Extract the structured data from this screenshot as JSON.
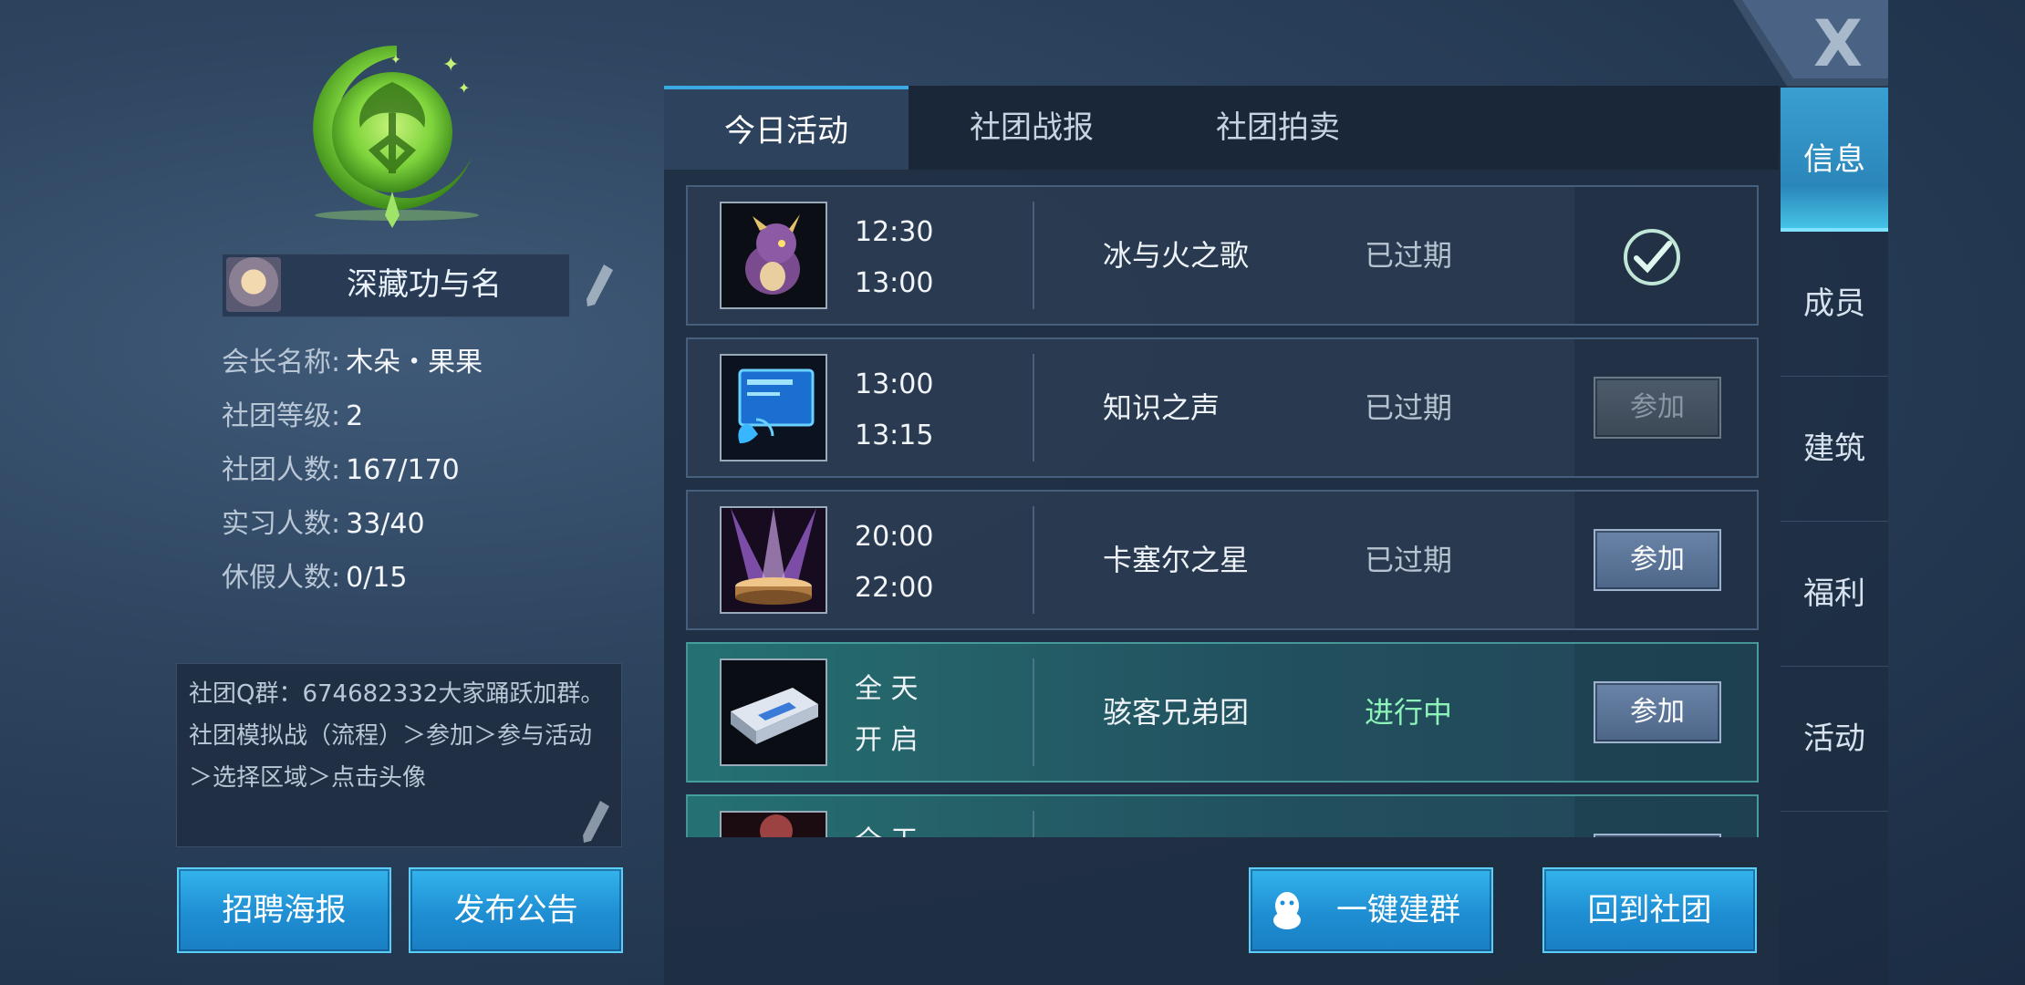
{
  "close_label": "X",
  "clan": {
    "name": "深藏功与名",
    "info": [
      {
        "label": "会长名称:",
        "value": "木朵・果果"
      },
      {
        "label": "社团等级:",
        "value": "2"
      },
      {
        "label": "社团人数:",
        "value": "167/170"
      },
      {
        "label": "实习人数:",
        "value": "33/40"
      },
      {
        "label": "休假人数:",
        "value": "0/15"
      }
    ],
    "notice_lines": [
      "社团Q群：674682332大家踊跃加群。",
      "社团模拟战（流程）＞参加＞参与活动",
      "＞选择区域＞点击头像"
    ]
  },
  "left_buttons": {
    "recruit": "招聘海报",
    "announce": "发布公告"
  },
  "tabs": [
    {
      "label": "今日活动",
      "active": true
    },
    {
      "label": "社团战报",
      "active": false
    },
    {
      "label": "社团拍卖",
      "active": false
    }
  ],
  "activities": [
    {
      "start": "12:30",
      "end": "13:00",
      "name": "冰与火之歌",
      "status": "已过期",
      "action": "done",
      "icon": "dragon-icon"
    },
    {
      "start": "13:00",
      "end": "13:15",
      "name": "知识之声",
      "status": "已过期",
      "action": "参加",
      "action_disabled": true,
      "icon": "phone-screen-icon"
    },
    {
      "start": "20:00",
      "end": "22:00",
      "name": "卡塞尔之星",
      "status": "已过期",
      "action": "参加",
      "icon": "stage-lights-icon"
    },
    {
      "start": "全 天",
      "end": "开 启",
      "name": "骇客兄弟团",
      "status": "进行中",
      "action": "参加",
      "icon": "hard-drive-icon"
    },
    {
      "start": "全 天",
      "end": "",
      "name": "",
      "status": "",
      "action": "",
      "icon": "partial-icon"
    }
  ],
  "bottom_buttons": {
    "group": "一键建群",
    "return": "回到社团"
  },
  "sidebar": [
    {
      "label": "信息",
      "active": true
    },
    {
      "label": "成员",
      "active": false
    },
    {
      "label": "建筑",
      "active": false
    },
    {
      "label": "福利",
      "active": false
    },
    {
      "label": "活动",
      "active": false
    }
  ],
  "colors": {
    "accent_blue": "#2b9fe0",
    "active_green": "#8ef3b8",
    "emblem_green": "#7ed43c"
  }
}
